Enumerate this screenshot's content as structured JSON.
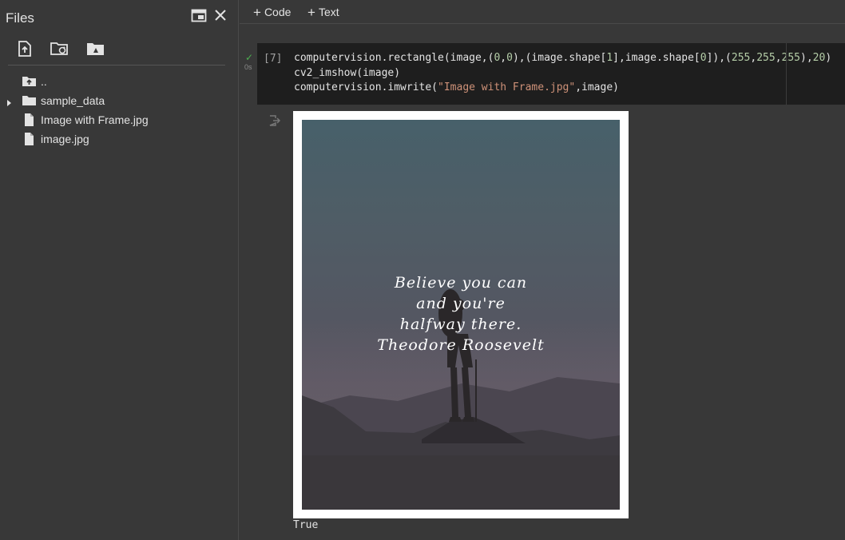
{
  "sidebar": {
    "title": "Files",
    "tree": [
      {
        "label": "..",
        "kind": "parent-folder"
      },
      {
        "label": "sample_data",
        "kind": "folder",
        "expandable": true
      },
      {
        "label": "Image with Frame.jpg",
        "kind": "file"
      },
      {
        "label": "image.jpg",
        "kind": "file"
      }
    ]
  },
  "topbar": {
    "add_code": "Code",
    "add_text": "Text"
  },
  "cell": {
    "exec_count": "[7]",
    "status": "✓",
    "duration": "0s",
    "code_lines": [
      "computervision.rectangle(image,(0,0),(image.shape[1],image.shape[0]),(255,255,255),20)",
      "cv2_imshow(image)",
      "computervision.imwrite(\"Image with Frame.jpg\",image)"
    ]
  },
  "output": {
    "quote": [
      "Believe you can",
      "and you're",
      "halfway there.",
      "Theodore Roosevelt"
    ],
    "result_text": "True"
  },
  "colors": {
    "background": "#383838",
    "code_bg": "#1e1e1e",
    "number": "#b5cea8",
    "string": "#ce9178",
    "success": "#4caf50"
  }
}
